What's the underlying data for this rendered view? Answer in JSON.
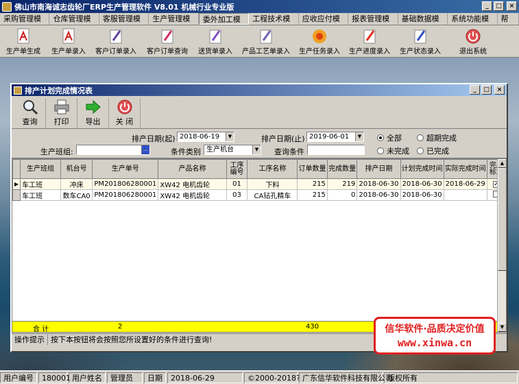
{
  "app": {
    "title": "佛山市南海诚志齿轮厂ERP生产管理软件  V8.01 机械行业专业版"
  },
  "menu": [
    "采购管理模块",
    "仓库管理模块",
    "客服管理模块",
    "生产管理模块",
    "委外加工模块",
    "工程技术模块",
    "应收应付模块",
    "报表管理模块",
    "基础数据模块",
    "系统功能模块",
    "帮助"
  ],
  "toolbar": [
    {
      "label": "生产单生成",
      "icon": "pdf-doc-icon"
    },
    {
      "label": "生产单录入",
      "icon": "pdf-doc-icon"
    },
    {
      "label": "客户订单录入",
      "icon": "pen-doc-icon"
    },
    {
      "label": "客户订单查询",
      "icon": "pen-doc-icon"
    },
    {
      "label": "送货单录入",
      "icon": "pen-doc-icon"
    },
    {
      "label": "产品工艺单录入",
      "icon": "pen-doc-icon"
    },
    {
      "label": "生产任务录入",
      "icon": "flower-icon"
    },
    {
      "label": "生产进度录入",
      "icon": "pen-doc-icon"
    },
    {
      "label": "生产状态录入",
      "icon": "pen-doc-icon"
    },
    {
      "label": "退出系统",
      "icon": "exit-icon"
    }
  ],
  "child": {
    "title": "排产计划完成情况表",
    "toolbar": [
      {
        "label": "查询",
        "icon": "magnifier-icon"
      },
      {
        "label": "打印",
        "icon": "printer-icon"
      },
      {
        "label": "导出",
        "icon": "arrow-right-icon"
      },
      {
        "label": "关 闭",
        "icon": "power-icon"
      }
    ],
    "filters": {
      "date_from_label": "排产日期(起)",
      "date_from": "2018-06-19",
      "date_to_label": "排产日期(止)",
      "date_to": "2019-06-01",
      "team_label": "生产班组:",
      "team": "",
      "cond_type_label": "条件类别",
      "cond_type": "生产机台",
      "query_cond_label": "查询条件",
      "query_cond": "",
      "radios": [
        {
          "label": "全部",
          "checked": true
        },
        {
          "label": "超期完成",
          "checked": false
        },
        {
          "label": "未完成",
          "checked": false
        },
        {
          "label": "已完成",
          "checked": false
        }
      ]
    },
    "grid": {
      "columns": [
        "生产班组",
        "机台号",
        "生产单号",
        "产品名称",
        "工序编号",
        "工序名称",
        "订单数量",
        "完成数量",
        "排产日期",
        "计划完成时间",
        "实际完成时间",
        "完成标志"
      ],
      "rows": [
        {
          "team": "车工班",
          "machine": "冲床",
          "order": "PM201806280001",
          "product": "XW42 电机齿轮",
          "step_no": "01",
          "step_name": "下料",
          "qty": "215",
          "done": "219",
          "sched": "2018-06-30",
          "plan": "2018-06-30",
          "actual": "2018-06-29",
          "flag": true
        },
        {
          "team": "车工班",
          "machine": "数车CA0",
          "order": "PM201806280001",
          "product": "XW42 电机齿轮",
          "step_no": "03",
          "step_name": "CA钻孔精车",
          "qty": "215",
          "done": "0",
          "sched": "2018-06-30",
          "plan": "2018-06-30",
          "actual": "",
          "flag": false
        }
      ],
      "totals": {
        "label": "合 计",
        "count": "2",
        "qty": "430"
      }
    },
    "hint": {
      "label": "操作提示",
      "text": "按下本按钮将会按照您所设置好的条件进行查询!"
    }
  },
  "ad": {
    "line1": "信华软件·品质决定价值",
    "line2": "www.xinwa.cn"
  },
  "status": {
    "user_id_label": "用户编号",
    "user_id": "180001",
    "user_name_label": "用户姓名",
    "user_name": "管理员",
    "date_label": "日期",
    "date": "2018-06-29",
    "copyright": "©2000-2018?",
    "company": "广东信华软件科技有限公司",
    "rights": "版权所有"
  }
}
